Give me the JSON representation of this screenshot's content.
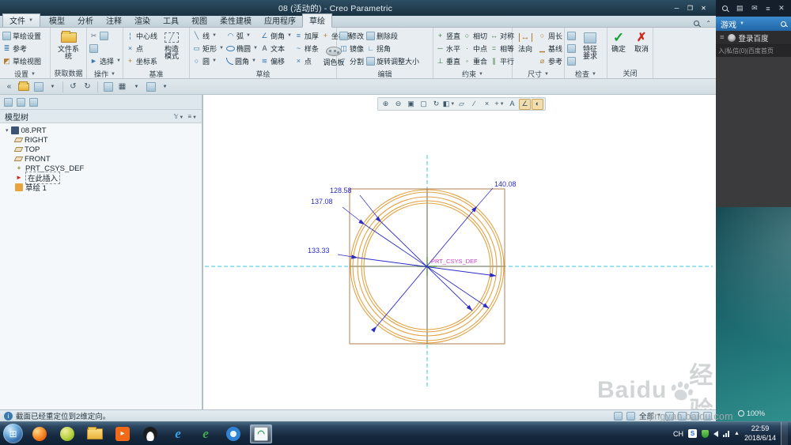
{
  "colors": {
    "dimension": "#2a2ac8",
    "circle": "#e2a243",
    "centerline": "#3cc8dc",
    "csys_label": "#c83cc8",
    "ok_green": "#18a038",
    "cancel_red": "#d02818"
  },
  "window": {
    "title": "08 (活动的) - Creo Parametric"
  },
  "tabs": {
    "file": "文件",
    "items": [
      "模型",
      "分析",
      "注释",
      "渲染",
      "工具",
      "视图",
      "柔性建模",
      "应用程序",
      "草绘"
    ]
  },
  "ribbon": {
    "groups": [
      {
        "label": "设置",
        "buttons": [
          "草绘设置",
          "参考",
          "草绘视图"
        ]
      },
      {
        "label": "获取数据",
        "buttons": [
          "文件系统"
        ]
      },
      {
        "label": "操作",
        "buttons": [
          "选择"
        ]
      },
      {
        "label": "基准",
        "buttons": [
          "中心线",
          "点",
          "坐标系",
          "构造模式"
        ]
      },
      {
        "label": "草绘",
        "buttons": [
          "线",
          "矩形",
          "圆",
          "弧",
          "椭圆",
          "圆角",
          "倒角",
          "文本",
          "偏移",
          "加厚",
          "样条",
          "点",
          "坐标系",
          "调色板"
        ]
      },
      {
        "label": "编辑",
        "buttons": [
          "修改",
          "镜像",
          "分割",
          "删除段",
          "拐角",
          "旋转调整大小"
        ]
      },
      {
        "label": "约束",
        "buttons": [
          "竖直",
          "水平",
          "垂直",
          "相切",
          "中点",
          "重合",
          "对称",
          "相等",
          "平行"
        ]
      },
      {
        "label": "尺寸",
        "buttons": [
          "法向",
          "周长",
          "基线",
          "参考"
        ]
      },
      {
        "label": "检查",
        "buttons": [
          "特征要求"
        ]
      },
      {
        "label": "关闭",
        "buttons": [
          "确定",
          "取消"
        ]
      }
    ]
  },
  "model_tree": {
    "header": "模型树",
    "items": [
      "08.PRT",
      "RIGHT",
      "TOP",
      "FRONT",
      "PRT_CSYS_DEF",
      "在此插入",
      "草绘 1"
    ]
  },
  "canvas": {
    "dims": {
      "d140": "140.08",
      "d137": "137.08",
      "d128": "128.58",
      "d133": "133.33"
    },
    "csys_label": "PRT_CSYS_DEF"
  },
  "status": {
    "message": "截面已经重定位到2维定向。",
    "filter": "全部"
  },
  "right_panel": {
    "game": "游戏",
    "login": "登录百度",
    "links": "入|私信(0)|百度首页",
    "zoom": "100%"
  },
  "taskbar": {
    "lang": "CH",
    "time": "22:59",
    "date": "2018/6/14"
  },
  "watermark": {
    "brand": "Baidu",
    "brand_cn": "经验",
    "url": "jingyan.baidu.com"
  }
}
